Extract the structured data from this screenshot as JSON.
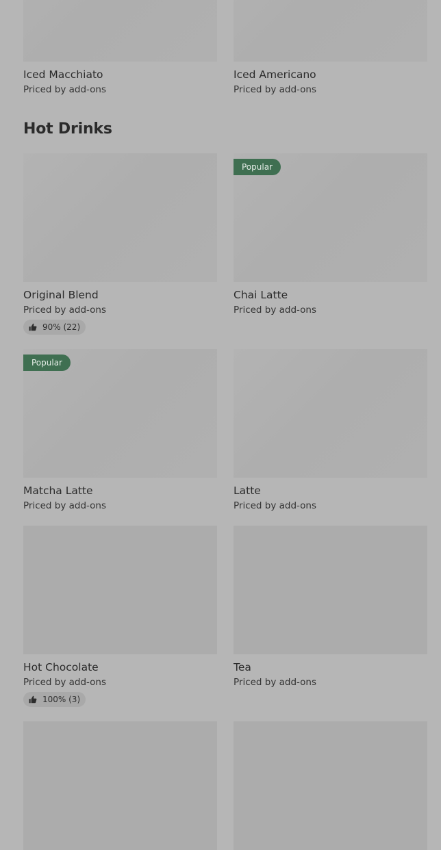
{
  "sections": {
    "iced": {
      "items": [
        {
          "name": "Iced Macchiato",
          "price": "Priced by add-ons"
        },
        {
          "name": "Iced Americano",
          "price": "Priced by add-ons"
        }
      ]
    },
    "hot": {
      "title": "Hot Drinks",
      "items": [
        {
          "name": "Original Blend",
          "price": "Priced by add-ons",
          "rating": "90% (22)"
        },
        {
          "name": "Chai Latte",
          "price": "Priced by add-ons",
          "badge": "Popular"
        },
        {
          "name": "Matcha Latte",
          "price": "Priced by add-ons",
          "badge": "Popular"
        },
        {
          "name": "Latte",
          "price": "Priced by add-ons"
        },
        {
          "name": "Hot Chocolate",
          "price": "Priced by add-ons",
          "rating": "100% (3)"
        },
        {
          "name": "Tea",
          "price": "Priced by add-ons"
        }
      ]
    }
  },
  "icons": {
    "rating": "thumbs-up-icon"
  },
  "colors": {
    "background": "#b6b6b6",
    "popular_badge": "#3f6f51",
    "rating_pill": "#a9a9a9"
  }
}
